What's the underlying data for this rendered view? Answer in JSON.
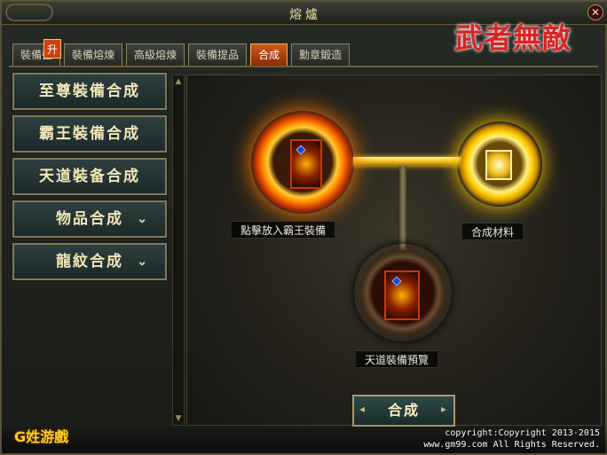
{
  "window": {
    "title": "熔爐",
    "close_icon": "close-icon"
  },
  "logo": {
    "text": "武者無敵"
  },
  "tabs": [
    {
      "label": "裝備強",
      "badge": "升",
      "active": false
    },
    {
      "label": "裝備熔煉",
      "active": false
    },
    {
      "label": "高級熔煉",
      "active": false
    },
    {
      "label": "裝備提品",
      "active": false
    },
    {
      "label": "合成",
      "active": true
    },
    {
      "label": "勳章鍛造",
      "active": false
    }
  ],
  "sidebar": {
    "items": [
      {
        "label": "至尊裝備合成",
        "expandable": false
      },
      {
        "label": "霸王裝備合成",
        "expandable": false
      },
      {
        "label": "天道裝备合成",
        "expandable": false
      },
      {
        "label": "物品合成",
        "expandable": true,
        "chevron": "chevron-down-icon"
      },
      {
        "label": "龍紋合成",
        "expandable": true,
        "chevron": "chevron-down-icon"
      }
    ]
  },
  "synthesis": {
    "main_slot_label": "點擊放入霸王裝備",
    "material_slot_label": "合成材料",
    "preview_slot_label": "天道裝備預覽",
    "action_button": "合成"
  },
  "footer": {
    "brand": "G姓游戲",
    "copyright": "copyright:Copyright 2013-2015",
    "rights": "www.gm99.com All Rights Reserved."
  },
  "colors": {
    "accent_active_tab": "#d05a18",
    "gold_text": "#f2e6b8",
    "glow_orange": "#ff8a00",
    "glow_gold": "#ffc800"
  }
}
